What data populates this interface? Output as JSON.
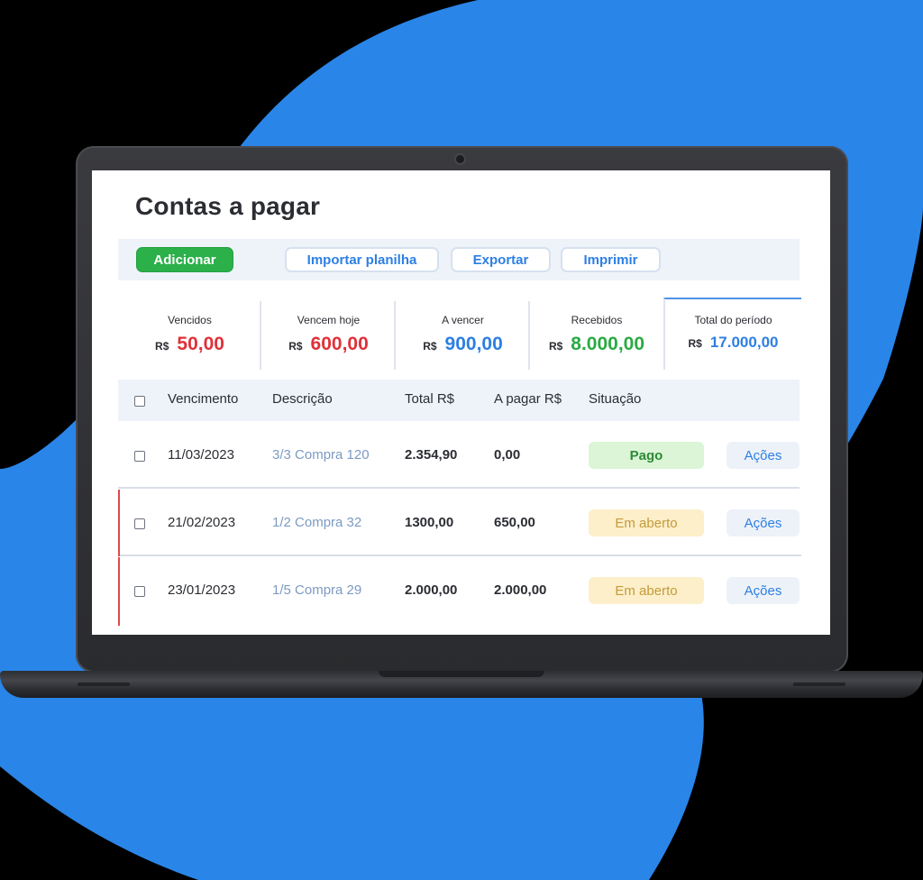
{
  "page": {
    "title": "Contas a pagar"
  },
  "colors": {
    "background_blob": "#2a85e8",
    "primary_green": "#2bb04a",
    "accent_blue": "#2d7fe3",
    "overdue_red": "#e0313a",
    "received_green": "#2baa44",
    "flag_red": "#e0474b"
  },
  "toolbar": {
    "add_label": "Adicionar",
    "import_label": "Importar planilha",
    "export_label": "Exportar",
    "print_label": "Imprimir"
  },
  "summary": {
    "currency": "R$",
    "cards": [
      {
        "label": "Vencidos",
        "value": "50,00",
        "color": "#e0313a"
      },
      {
        "label": "Vencem hoje",
        "value": "600,00",
        "color": "#e0313a"
      },
      {
        "label": "A vencer",
        "value": "900,00",
        "color": "#2d7fe3"
      },
      {
        "label": "Recebidos",
        "value": "8.000,00",
        "color": "#2baa44"
      },
      {
        "label": "Total do período",
        "value": "17.000,00",
        "color": "#2d7fe3",
        "active": true
      }
    ]
  },
  "table": {
    "headers": {
      "due_date": "Vencimento",
      "description": "Descrição",
      "total": "Total R$",
      "to_pay": "A pagar R$",
      "status": "Situação"
    },
    "rows": [
      {
        "due_date": "11/03/2023",
        "description": "3/3 Compra 120",
        "total": "2.354,90",
        "to_pay": "0,00",
        "status": "Pago",
        "status_type": "paid",
        "actions": "Ações",
        "flagged": false
      },
      {
        "due_date": "21/02/2023",
        "description": "1/2 Compra 32",
        "total": "1300,00",
        "to_pay": "650,00",
        "status": "Em aberto",
        "status_type": "open",
        "actions": "Ações",
        "flagged": true
      },
      {
        "due_date": "23/01/2023",
        "description": "1/5 Compra 29",
        "total": "2.000,00",
        "to_pay": "2.000,00",
        "status": "Em aberto",
        "status_type": "open",
        "actions": "Ações",
        "flagged": true
      }
    ]
  }
}
